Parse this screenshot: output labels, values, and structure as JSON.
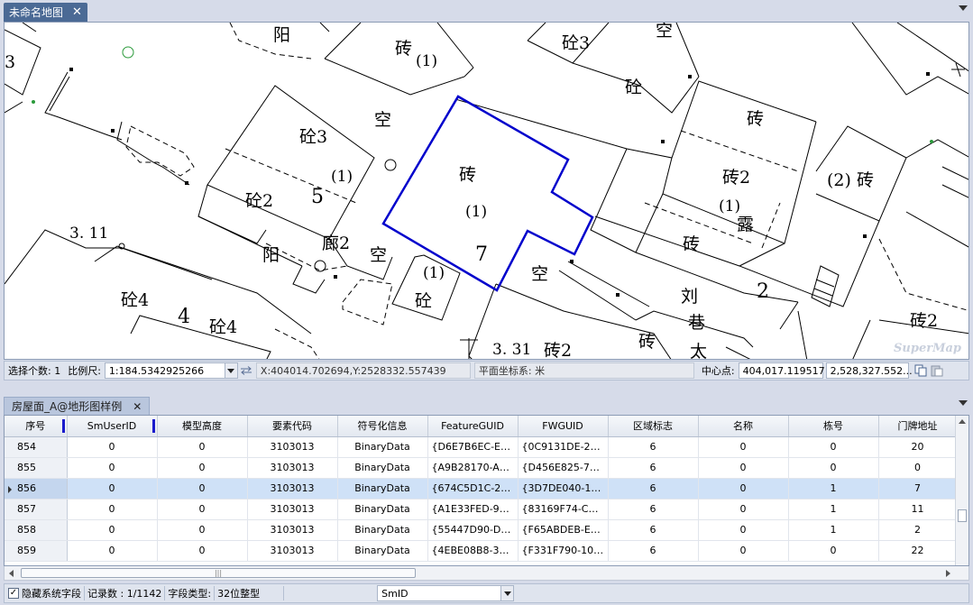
{
  "map_doc": {
    "tab_title": "未命名地图",
    "close_glyph": "✕",
    "map_labels": [
      {
        "text": "阳",
        "cls": ""
      },
      {
        "text": "砖",
        "cls": ""
      },
      {
        "text": "(1)",
        "cls": "sm"
      },
      {
        "text": "砼3",
        "cls": ""
      },
      {
        "text": "空",
        "cls": ""
      },
      {
        "text": "砼",
        "cls": ""
      },
      {
        "text": "空",
        "cls": ""
      },
      {
        "text": "砖",
        "cls": ""
      },
      {
        "text": "砼3",
        "cls": ""
      },
      {
        "text": "(1)",
        "cls": "sm"
      },
      {
        "text": "5",
        "cls": "num"
      },
      {
        "text": "砼2",
        "cls": ""
      },
      {
        "text": "砖",
        "cls": ""
      },
      {
        "text": "(1)",
        "cls": "sm"
      },
      {
        "text": "7",
        "cls": "num"
      },
      {
        "text": "砖2",
        "cls": ""
      },
      {
        "text": "(1)",
        "cls": "sm"
      },
      {
        "text": "(2) 砖",
        "cls": ""
      },
      {
        "text": "露",
        "cls": ""
      },
      {
        "text": "3. 11",
        "cls": "sm"
      },
      {
        "text": "阳",
        "cls": ""
      },
      {
        "text": "廊2",
        "cls": ""
      },
      {
        "text": "空",
        "cls": ""
      },
      {
        "text": "砖",
        "cls": ""
      },
      {
        "text": "(1)",
        "cls": "sm"
      },
      {
        "text": "砼",
        "cls": ""
      },
      {
        "text": "空",
        "cls": ""
      },
      {
        "text": "刘",
        "cls": ""
      },
      {
        "text": "2",
        "cls": "num"
      },
      {
        "text": "砼4",
        "cls": ""
      },
      {
        "text": "4",
        "cls": "num"
      },
      {
        "text": "砼4",
        "cls": ""
      },
      {
        "text": "巷",
        "cls": ""
      },
      {
        "text": "砖",
        "cls": ""
      },
      {
        "text": "3. 31",
        "cls": "sm"
      },
      {
        "text": "砖2",
        "cls": ""
      },
      {
        "text": "太",
        "cls": ""
      },
      {
        "text": "砖2",
        "cls": ""
      },
      {
        "text": "3",
        "cls": ""
      }
    ],
    "watermark": "SuperMap"
  },
  "map_status": {
    "selected_count": "选择个数: 1",
    "scale_label": "比例尺:",
    "scale_value": "1:184.5342925266",
    "coords": "X:404014.702694,Y:2528332.557439",
    "coord_system": "平面坐标系: 米",
    "center_label": "中心点:",
    "center_x": "404,017.119517",
    "center_y": "2,528,327.552..."
  },
  "panel": {
    "tab_title": "房屋面_A@地形图样例",
    "close_glyph": "✕"
  },
  "table": {
    "columns": [
      "序号",
      "SmUserID",
      "模型高度",
      "要素代码",
      "符号化信息",
      "FeatureGUID",
      "FWGUID",
      "区域标志",
      "名称",
      "栋号",
      "门牌地址"
    ],
    "rows": [
      [
        "854",
        "0",
        "0",
        "3103013",
        "BinaryData",
        "{D6E7B6EC-E2...",
        "{0C9131DE-2E...",
        "6",
        "0",
        "0",
        "20"
      ],
      [
        "855",
        "0",
        "0",
        "3103013",
        "BinaryData",
        "{A9B28170-AE...",
        "{D456E825-7C...",
        "6",
        "0",
        "0",
        "0"
      ],
      [
        "856",
        "0",
        "0",
        "3103013",
        "BinaryData",
        "{674C5D1C-22...",
        "{3D7DE040-18...",
        "6",
        "0",
        "1",
        "7"
      ],
      [
        "857",
        "0",
        "0",
        "3103013",
        "BinaryData",
        "{A1E33FED-9B...",
        "{83169F74-CFE...",
        "6",
        "0",
        "1",
        "11"
      ],
      [
        "858",
        "0",
        "0",
        "3103013",
        "BinaryData",
        "{55447D90-D6...",
        "{F65ABDEB-E6...",
        "6",
        "0",
        "1",
        "2"
      ],
      [
        "859",
        "0",
        "0",
        "3103013",
        "BinaryData",
        "{4EBE08B8-38...",
        "{F331F790-106...",
        "6",
        "0",
        "0",
        "22"
      ]
    ],
    "selected_row_index": 2
  },
  "hscroll_grip": "|||",
  "bottom_bar": {
    "hide_system_fields": "隐藏系统字段",
    "record_count": "记录数 : 1/1142",
    "field_type_label": "字段类型:",
    "field_type_value": "32位整型",
    "field_select": "SmID"
  },
  "colors": {
    "selection_outline": "#0000cc",
    "tab_active": "#4b6a95",
    "selected_row": "#cfe1f7"
  }
}
